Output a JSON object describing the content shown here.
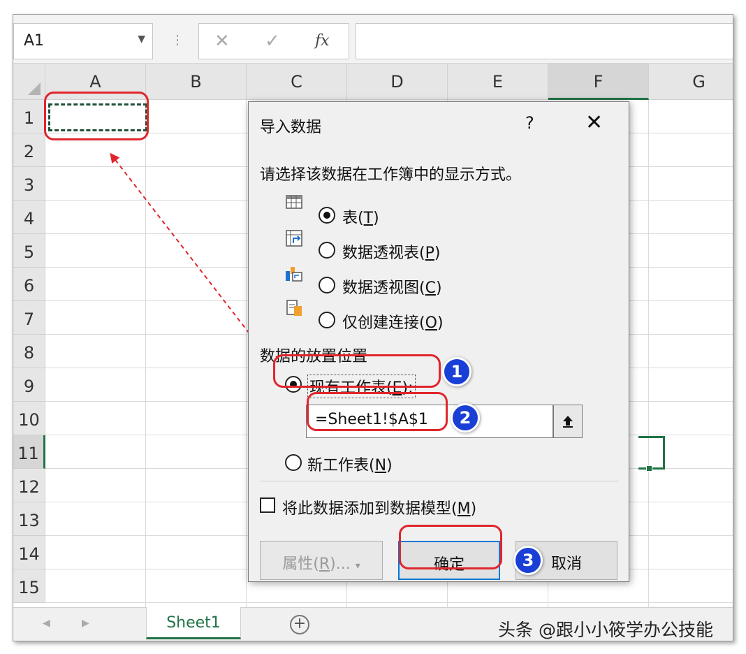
{
  "formula_bar": {
    "name_box": "A1",
    "cancel_symbol": "✕",
    "enter_symbol": "✓",
    "fx_symbol": "fx"
  },
  "columns": [
    "A",
    "B",
    "C",
    "D",
    "E",
    "F",
    "G"
  ],
  "rows": [
    "1",
    "2",
    "3",
    "4",
    "5",
    "6",
    "7",
    "8",
    "9",
    "10",
    "11",
    "12",
    "13",
    "14",
    "15"
  ],
  "sheet_tabs": {
    "active_tab": "Sheet1",
    "add_symbol": "+"
  },
  "dialog": {
    "title": "导入数据",
    "help": "?",
    "close": "✕",
    "prompt": "请选择该数据在工作簿中的显示方式。",
    "display_options": [
      {
        "label": "表",
        "key": "T",
        "selected": true
      },
      {
        "label": "数据透视表",
        "key": "P",
        "selected": false
      },
      {
        "label": "数据透视图",
        "key": "C",
        "selected": false
      },
      {
        "label": "仅创建连接",
        "key": "O",
        "selected": false
      }
    ],
    "placement_heading": "数据的放置位置",
    "existing_sheet": {
      "label": "现有工作表",
      "key": "E",
      "suffix": ":",
      "selected": true
    },
    "reference_value": "=Sheet1!$A$1",
    "new_sheet": {
      "label": "新工作表",
      "key": "N",
      "selected": false
    },
    "data_model": {
      "label": "将此数据添加到数据模型",
      "key": "M",
      "checked": false
    },
    "buttons": {
      "properties": {
        "label": "属性",
        "key": "R",
        "suffix": "...",
        "arrow": "▾"
      },
      "ok": "确定",
      "cancel": "取消"
    }
  },
  "annotations": {
    "badge_1": "1",
    "badge_2": "2",
    "badge_3": "3"
  },
  "watermark": "头条 @跟小小筱学办公技能",
  "colors": {
    "excel_green": "#217346",
    "annotation_red": "#e0262c",
    "badge_blue": "#1a3fd6"
  }
}
